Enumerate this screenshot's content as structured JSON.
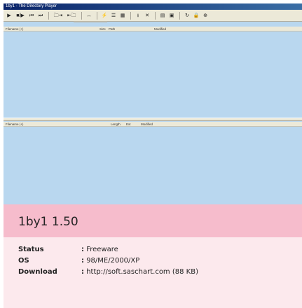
{
  "window": {
    "title": "1by1 - The Directory Player"
  },
  "toolbar": {
    "buttons": [
      {
        "name": "play-button",
        "glyph": "▶"
      },
      {
        "name": "play-pause-button",
        "glyph": "■/▶"
      },
      {
        "name": "prev-track-button",
        "glyph": "⏮"
      },
      {
        "name": "next-track-button",
        "glyph": "⏭"
      },
      {
        "name": "open-folder-button",
        "glyph": "🗀⇥"
      },
      {
        "name": "folder-up-button",
        "glyph": "⇤🗀"
      },
      {
        "name": "repeat-button",
        "glyph": "↔"
      },
      {
        "name": "shuffle-button",
        "glyph": "⚡"
      },
      {
        "name": "playlist-button",
        "glyph": "☰"
      },
      {
        "name": "explorer-button",
        "glyph": "▦"
      },
      {
        "name": "download-button",
        "glyph": "⭳"
      },
      {
        "name": "delete-button",
        "glyph": "✕"
      },
      {
        "name": "list-button",
        "glyph": "▤"
      },
      {
        "name": "view-button",
        "glyph": "▣"
      },
      {
        "name": "refresh-button",
        "glyph": "↻"
      },
      {
        "name": "lock-button",
        "glyph": "🔒"
      },
      {
        "name": "options-button",
        "glyph": "⊕"
      }
    ]
  },
  "top_list": {
    "columns": [
      "Filename (+)",
      "Size",
      "Path",
      "Modified"
    ]
  },
  "bottom_list": {
    "columns": [
      "Filename (+)",
      "Length",
      "Ext",
      "Modified"
    ]
  },
  "app": {
    "title": "1by1 1.50",
    "rows": [
      {
        "label": "Status",
        "value": "Freeware"
      },
      {
        "label": "OS",
        "value": "98/ME/2000/XP"
      },
      {
        "label": "Download",
        "value": "http://soft.saschart.com (88 KB)"
      }
    ]
  },
  "colors": {
    "list_bg": "#b9d7ef",
    "header_bg": "#f6bccc",
    "info_bg": "#fce9ed"
  }
}
